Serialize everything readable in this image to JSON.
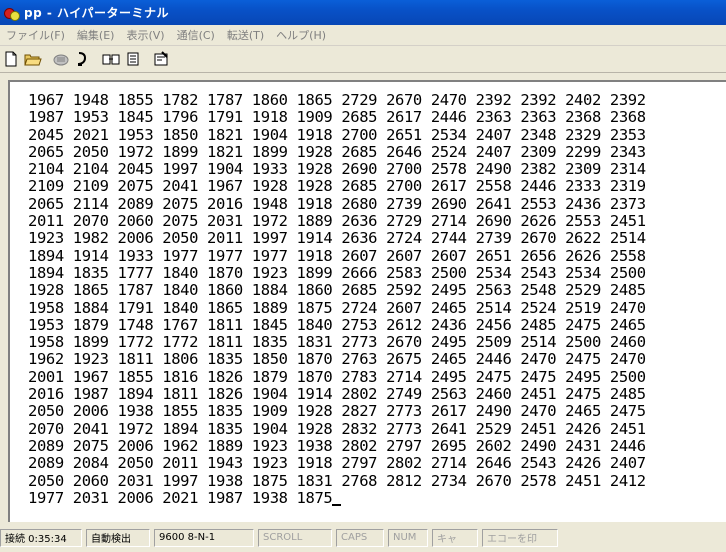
{
  "window": {
    "title": "pp - ハイパーターミナル"
  },
  "menu": [
    {
      "label": "ファイル(F)"
    },
    {
      "label": "編集(E)"
    },
    {
      "label": "表示(V)"
    },
    {
      "label": "通信(C)"
    },
    {
      "label": "転送(T)"
    },
    {
      "label": "ヘルプ(H)"
    }
  ],
  "toolbar": {
    "icons": [
      "new-file-icon",
      "open-folder-icon",
      "phone-connect-icon",
      "disconnect-icon",
      "send-icon",
      "receive-icon",
      "properties-icon"
    ]
  },
  "terminal": {
    "lines": [
      "1967 1948 1855 1782 1787 1860 1865 2729 2670 2470 2392 2392 2402 2392",
      "1987 1953 1845 1796 1791 1918 1909 2685 2617 2446 2363 2363 2368 2368",
      "2045 2021 1953 1850 1821 1904 1918 2700 2651 2534 2407 2348 2329 2353",
      "2065 2050 1972 1899 1821 1899 1928 2685 2646 2524 2407 2309 2299 2343",
      "2104 2104 2045 1997 1904 1933 1928 2690 2700 2578 2490 2382 2309 2314",
      "2109 2109 2075 2041 1967 1928 1928 2685 2700 2617 2558 2446 2333 2319",
      "2065 2114 2089 2075 2016 1948 1918 2680 2739 2690 2641 2553 2436 2373",
      "2011 2070 2060 2075 2031 1972 1889 2636 2729 2714 2690 2626 2553 2451",
      "1923 1982 2006 2050 2011 1997 1914 2636 2724 2744 2739 2670 2622 2514",
      "1894 1914 1933 1977 1977 1977 1918 2607 2607 2607 2651 2656 2626 2558",
      "1894 1835 1777 1840 1870 1923 1899 2666 2583 2500 2534 2543 2534 2500",
      "1928 1865 1787 1840 1860 1884 1860 2685 2592 2495 2563 2548 2529 2485",
      "1958 1884 1791 1840 1865 1889 1875 2724 2607 2465 2514 2524 2519 2470",
      "1953 1879 1748 1767 1811 1845 1840 2753 2612 2436 2456 2485 2475 2465",
      "1958 1899 1772 1772 1811 1835 1831 2773 2670 2495 2509 2514 2500 2460",
      "1962 1923 1811 1806 1835 1850 1870 2763 2675 2465 2446 2470 2475 2470",
      "2001 1967 1855 1816 1826 1879 1870 2783 2714 2495 2475 2475 2495 2500",
      "2016 1987 1894 1811 1826 1904 1914 2802 2749 2563 2460 2451 2475 2485",
      "2050 2006 1938 1855 1835 1909 1928 2827 2773 2617 2490 2470 2465 2475",
      "2070 2041 1972 1894 1835 1904 1928 2832 2773 2641 2529 2451 2426 2451",
      "2089 2075 2006 1962 1889 1923 1938 2802 2797 2695 2602 2490 2431 2446",
      "2089 2084 2050 2011 1943 1923 1918 2797 2802 2714 2646 2543 2426 2407",
      "2050 2060 2031 1997 1938 1875 1831 2768 2812 2734 2670 2578 2451 2412",
      "1977 2031 2006 2021 1987 1938 1875"
    ]
  },
  "status": {
    "connection": "接続 0:35:34",
    "detect": "自動検出",
    "params": "9600 8-N-1",
    "scroll": "SCROLL",
    "caps": "CAPS",
    "num": "NUM",
    "capture": "キャ",
    "echo": "エコーを印"
  },
  "colors": {
    "titlebar": "#0851c7",
    "background": "#ece9d8",
    "terminal_bg": "#ffffff",
    "dim_text": "#808080"
  }
}
